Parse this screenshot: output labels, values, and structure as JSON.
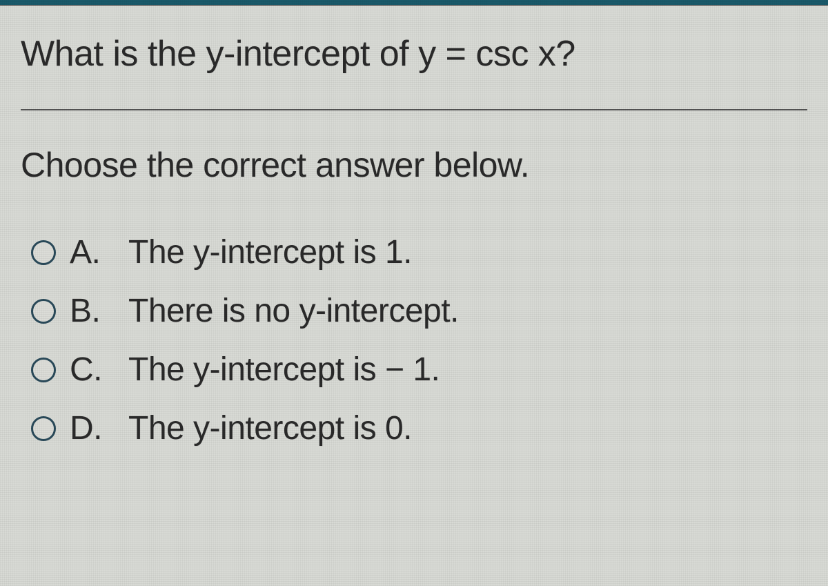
{
  "question": "What is the y-intercept of y = csc x?",
  "instruction": "Choose the correct answer below.",
  "options": [
    {
      "letter": "A.",
      "text": "The y-intercept is 1."
    },
    {
      "letter": "B.",
      "text": "There is no y-intercept."
    },
    {
      "letter": "C.",
      "text": "The y-intercept is − 1."
    },
    {
      "letter": "D.",
      "text": "The y-intercept is 0."
    }
  ]
}
